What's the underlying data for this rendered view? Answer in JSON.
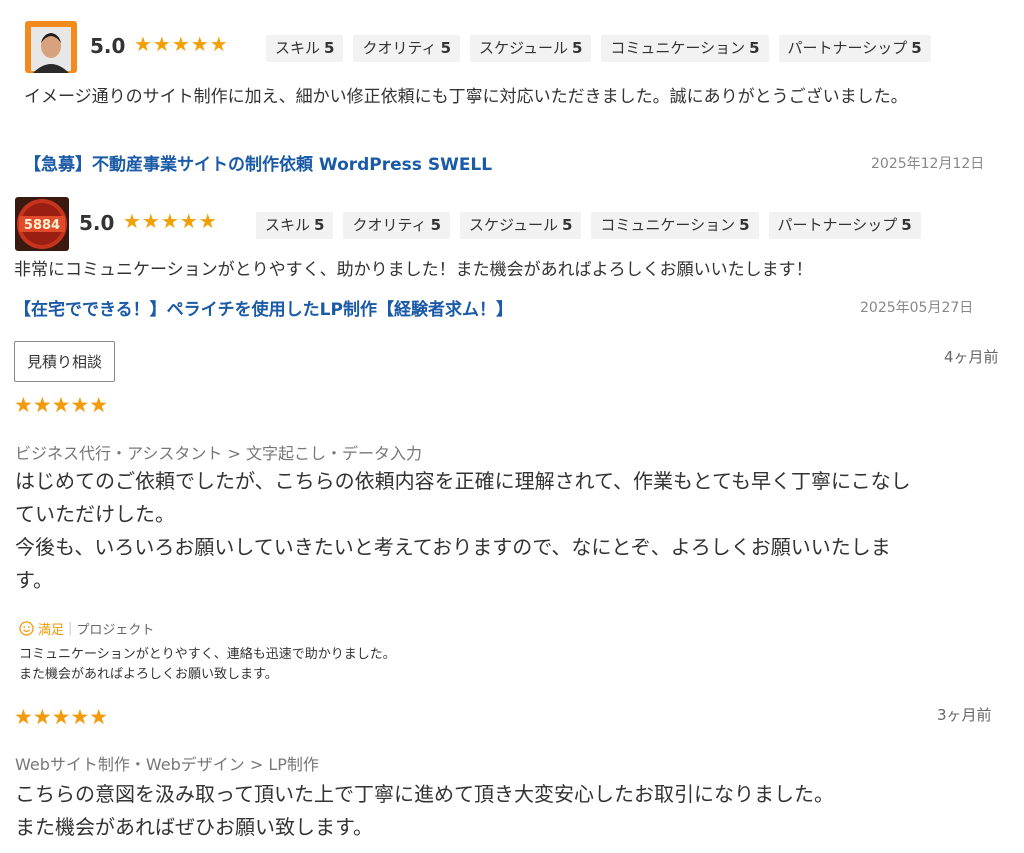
{
  "reviews": [
    {
      "score": "5.0",
      "stars": "★★★★★",
      "chips": [
        {
          "label": "スキル",
          "value": "5"
        },
        {
          "label": "クオリティ",
          "value": "5"
        },
        {
          "label": "スケジュール",
          "value": "5"
        },
        {
          "label": "コミュニケーション",
          "value": "5"
        },
        {
          "label": "パートナーシップ",
          "value": "5"
        }
      ],
      "comment": "イメージ通りのサイト制作に加え、細かい修正依頼にも丁寧に対応いただきました。誠にありがとうございました。",
      "link": "【急募】不動産事業サイトの制作依頼 WordPress SWELL",
      "date": "2025年12月12日"
    },
    {
      "score": "5.0",
      "stars": "★★★★★",
      "avatar_text": "5884",
      "chips": [
        {
          "label": "スキル",
          "value": "5"
        },
        {
          "label": "クオリティ",
          "value": "5"
        },
        {
          "label": "スケジュール",
          "value": "5"
        },
        {
          "label": "コミュニケーション",
          "value": "5"
        },
        {
          "label": "パートナーシップ",
          "value": "5"
        }
      ],
      "comment": "非常にコミュニケーションがとりやすく、助かりました！また機会があればよろしくお願いいたします！",
      "link": "【在宅でできる！】ペライチを使用したLP制作【経験者求ム！】",
      "date": "2025年05月27日"
    }
  ],
  "estimate_label": "見積り相談",
  "coconala": [
    {
      "ago": "4ヶ月前",
      "stars": "★★★★★",
      "category": "ビジネス代行・アシスタント > 文字起こし・データ入力",
      "body_line1": "はじめてのご依頼でしたが、こちらの依頼内容を正確に理解されて、作業もとても早く丁寧にこなし",
      "body_line2": "ていただけした。",
      "body_line3": "今後も、いろいろお願いしていきたいと考えておりますので、なにとぞ、よろしくお願いいたしま",
      "body_line4": "す。",
      "satisfaction": "満足",
      "project_label": "プロジェクト",
      "reply_line1": "コミュニケーションがとりやすく、連絡も迅速で助かりました。",
      "reply_line2": "また機会があればよろしくお願い致します。"
    },
    {
      "ago": "3ヶ月前",
      "stars": "★★★★★",
      "category": "Webサイト制作・Webデザイン > LP制作",
      "body_line1": "こちらの意図を汲み取って頂いた上で丁寧に進めて頂き大変安心したお取引になりました。",
      "body_line2": "また機会があればぜひお願い致します。"
    }
  ],
  "colors": {
    "star": "#f2a007",
    "link": "#1a5aa6",
    "chip_bg": "#f2f2f2"
  }
}
